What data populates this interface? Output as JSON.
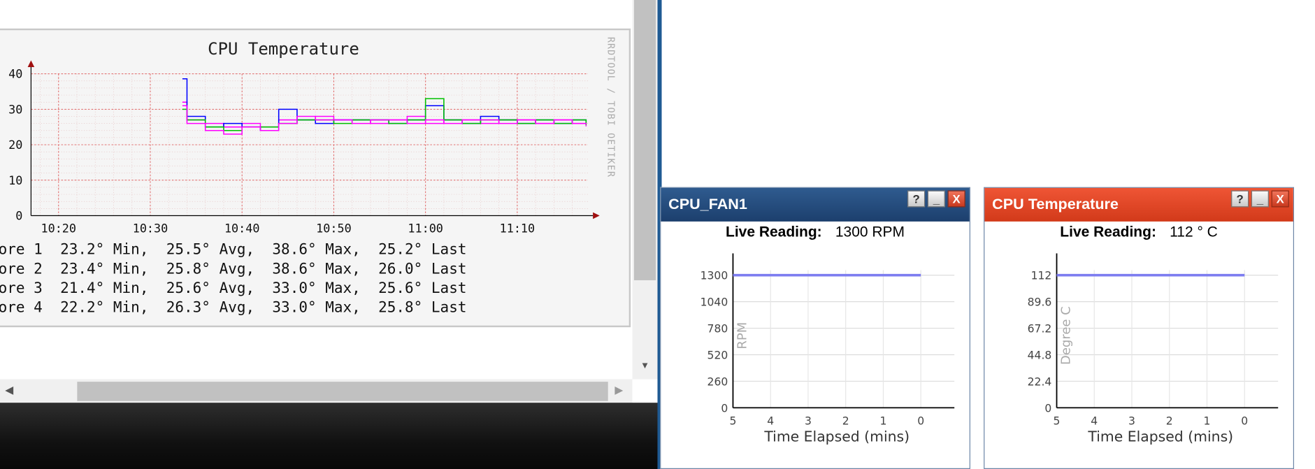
{
  "rrd": {
    "title": "CPU Temperature",
    "watermark": "RRDTOOL / TOBI OETIKER",
    "legend": [
      {
        "label": "ore 1",
        "min": "23.2° Min,",
        "avg": "25.5° Avg,",
        "max": "38.6° Max,",
        "last": "25.2° Last"
      },
      {
        "label": "ore 2",
        "min": "23.4° Min,",
        "avg": "25.8° Avg,",
        "max": "38.6° Max,",
        "last": "26.0° Last"
      },
      {
        "label": "ore 3",
        "min": "21.4° Min,",
        "avg": "25.6° Avg,",
        "max": "33.0° Max,",
        "last": "25.6° Last"
      },
      {
        "label": "ore 4",
        "min": "22.2° Min,",
        "avg": "26.3° Avg,",
        "max": "33.0° Max,",
        "last": "25.8° Last"
      }
    ],
    "colors": {
      "core1": "#ff00ff",
      "core2": "#0000ff",
      "core3": "#00c000",
      "core4": "#ff00ff",
      "grid": "#e06060",
      "axis": "#000000"
    }
  },
  "widgets": {
    "fan": {
      "title": "CPU_FAN1",
      "live_label": "Live Reading:",
      "live_value": "1300 RPM",
      "help": "?",
      "minimize": "_",
      "close": "X"
    },
    "temp": {
      "title": "CPU Temperature",
      "live_label": "Live Reading:",
      "live_value": "112 ° C",
      "help": "?",
      "minimize": "_",
      "close": "X"
    }
  },
  "chart_data": [
    {
      "type": "line",
      "title": "CPU Temperature",
      "x_ticks": [
        "10:20",
        "10:30",
        "10:40",
        "10:50",
        "11:00",
        "11:10"
      ],
      "y_ticks": [
        0,
        10,
        20,
        30,
        40
      ],
      "ylim": [
        0,
        40
      ],
      "grid": true,
      "x": [
        "10:33.5",
        "10:34",
        "10:36",
        "10:38",
        "10:40",
        "10:42",
        "10:44",
        "10:46",
        "10:48",
        "10:50",
        "10:52",
        "10:54",
        "10:56",
        "10:58",
        "11:00",
        "11:02",
        "11:04",
        "11:06",
        "11:08",
        "11:10",
        "11:12",
        "11:14",
        "11:16",
        "11:17.5"
      ],
      "series": [
        {
          "name": "ore 1",
          "color": "#ff00ff",
          "values": [
            32,
            27,
            26,
            25,
            26,
            25,
            27,
            27,
            28,
            27,
            27,
            26,
            27,
            28,
            26,
            27,
            27,
            26,
            27,
            27,
            26,
            27,
            26,
            25.2
          ]
        },
        {
          "name": "ore 2",
          "color": "#0000ff",
          "values": [
            38.6,
            28,
            25,
            26,
            25,
            24,
            30,
            27,
            26,
            27,
            27,
            27,
            26,
            27,
            31,
            27,
            26,
            28,
            27,
            26,
            27,
            26,
            27,
            26.0
          ]
        },
        {
          "name": "ore 3",
          "color": "#00c000",
          "values": [
            30,
            27,
            25,
            24,
            25,
            25,
            26,
            27,
            27,
            26,
            27,
            27,
            26,
            27,
            33,
            27,
            26,
            27,
            27,
            26,
            27,
            26,
            27,
            25.6
          ]
        },
        {
          "name": "ore 4",
          "color": "#ff00ff",
          "values": [
            31,
            26,
            24,
            23,
            25,
            24,
            26,
            28,
            27,
            27,
            26,
            27,
            27,
            26,
            27,
            26,
            27,
            27,
            26,
            27,
            26,
            27,
            26,
            25.8
          ]
        }
      ]
    },
    {
      "type": "line",
      "xlabel": "Time Elapsed (mins)",
      "ylabel": "RPM",
      "x_ticks": [
        5,
        4,
        3,
        2,
        1,
        0
      ],
      "y_ticks": [
        0,
        260,
        520,
        780,
        1040,
        1300
      ],
      "ylim": [
        0,
        1300
      ],
      "xlim": [
        5,
        0
      ],
      "grid": true,
      "series": [
        {
          "color": "#7d7df0",
          "x": [
            5,
            0
          ],
          "values": [
            1300,
            1300
          ]
        }
      ]
    },
    {
      "type": "line",
      "xlabel": "Time Elapsed (mins)",
      "ylabel": "Degree C",
      "x_ticks": [
        5,
        4,
        3,
        2,
        1,
        0
      ],
      "y_ticks": [
        0,
        22.4,
        44.8,
        67.2,
        89.6,
        112
      ],
      "ylim": [
        0,
        112
      ],
      "xlim": [
        5,
        0
      ],
      "grid": true,
      "series": [
        {
          "color": "#7d7df0",
          "x": [
            5,
            0
          ],
          "values": [
            112,
            112
          ]
        }
      ]
    }
  ]
}
